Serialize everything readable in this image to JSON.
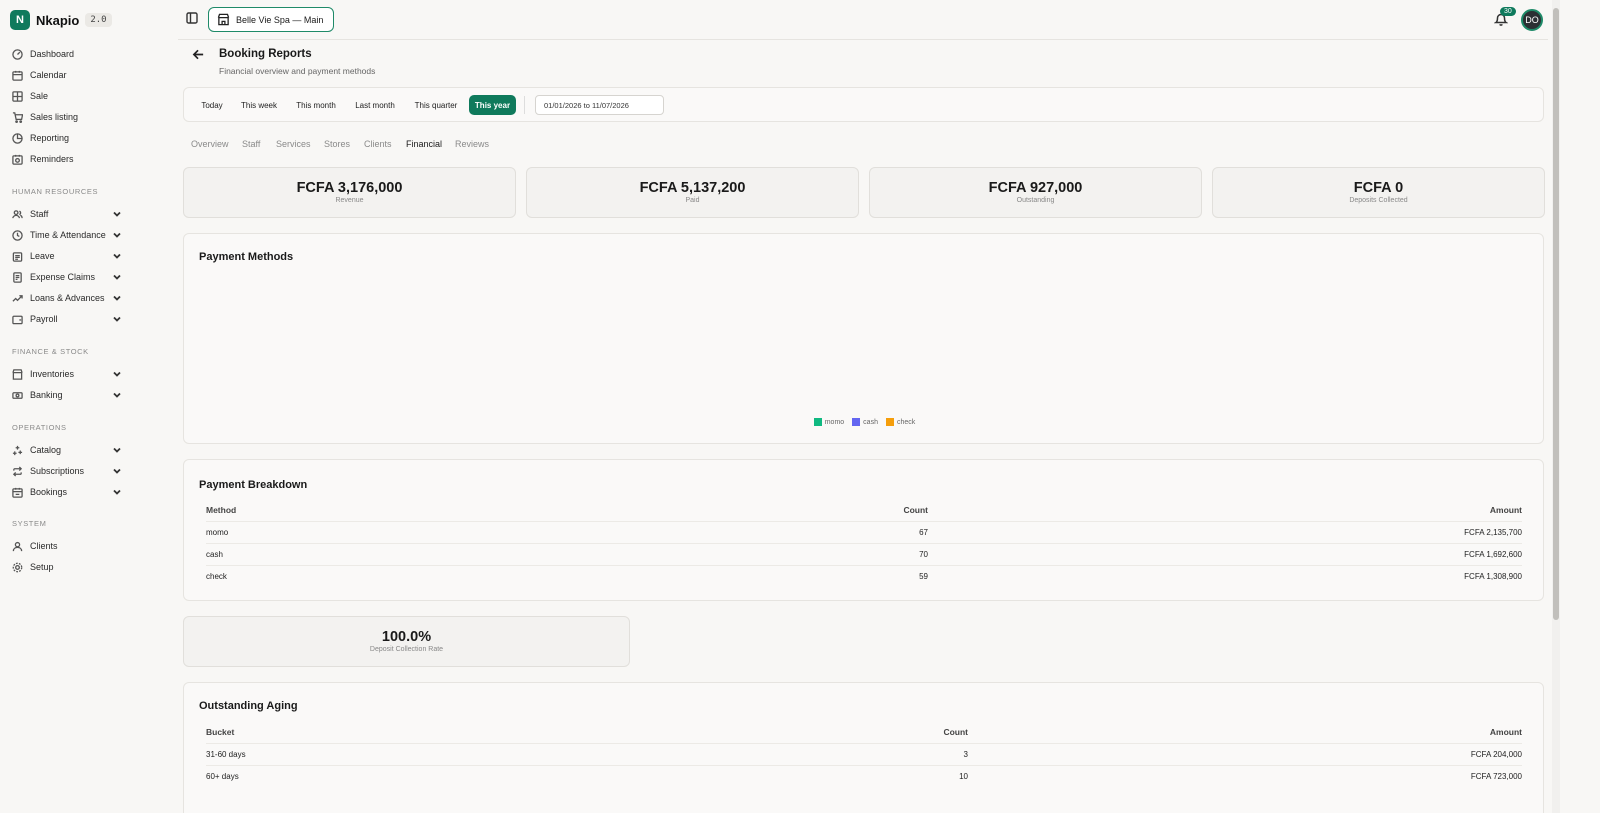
{
  "brand": {
    "initial": "N",
    "name": "Nkapio",
    "version": "2.0"
  },
  "nav": {
    "top": [
      {
        "label": "Dashboard",
        "icon": "dashboard-icon"
      },
      {
        "label": "Calendar",
        "icon": "calendar-icon"
      },
      {
        "label": "Sale",
        "icon": "sale-icon"
      },
      {
        "label": "Sales listing",
        "icon": "cart-icon"
      },
      {
        "label": "Reporting",
        "icon": "chart-icon"
      },
      {
        "label": "Reminders",
        "icon": "reminder-icon"
      }
    ],
    "sections": [
      {
        "label": "HUMAN RESOURCES",
        "items": [
          {
            "label": "Staff"
          },
          {
            "label": "Time & Attendance"
          },
          {
            "label": "Leave"
          },
          {
            "label": "Expense Claims"
          },
          {
            "label": "Loans & Advances"
          },
          {
            "label": "Payroll"
          }
        ]
      },
      {
        "label": "FINANCE & STOCK",
        "items": [
          {
            "label": "Inventories"
          },
          {
            "label": "Banking"
          }
        ]
      },
      {
        "label": "OPERATIONS",
        "items": [
          {
            "label": "Catalog"
          },
          {
            "label": "Subscriptions"
          },
          {
            "label": "Bookings"
          }
        ]
      },
      {
        "label": "SYSTEM",
        "items": [
          {
            "label": "Clients"
          },
          {
            "label": "Setup"
          }
        ]
      }
    ]
  },
  "topbar": {
    "store": "Belle Vie Spa — Main",
    "notifications": "30",
    "avatar": "DO"
  },
  "page": {
    "title": "Booking Reports",
    "subtitle": "Financial overview and payment methods"
  },
  "filters": {
    "buttons": [
      "Today",
      "This week",
      "This month",
      "Last month",
      "This quarter",
      "This year"
    ],
    "active": "This year",
    "date_range": "01/01/2026 to 11/07/2026"
  },
  "tabs": [
    "Overview",
    "Staff",
    "Services",
    "Stores",
    "Clients",
    "Financial",
    "Reviews"
  ],
  "active_tab": "Financial",
  "stats": [
    {
      "value": "FCFA 3,176,000",
      "label": "Revenue"
    },
    {
      "value": "FCFA 5,137,200",
      "label": "Paid"
    },
    {
      "value": "FCFA 927,000",
      "label": "Outstanding"
    },
    {
      "value": "FCFA 0",
      "label": "Deposits Collected"
    }
  ],
  "payment_methods": {
    "title": "Payment Methods",
    "legend": [
      {
        "label": "momo",
        "color": "#10b981"
      },
      {
        "label": "cash",
        "color": "#6366f1"
      },
      {
        "label": "check",
        "color": "#f59e0b"
      }
    ]
  },
  "payment_breakdown": {
    "title": "Payment Breakdown",
    "headers": [
      "Method",
      "Count",
      "Amount"
    ],
    "rows": [
      [
        "momo",
        "67",
        "FCFA 2,135,700"
      ],
      [
        "cash",
        "70",
        "FCFA 1,692,600"
      ],
      [
        "check",
        "59",
        "FCFA 1,308,900"
      ]
    ]
  },
  "deposit_rate": {
    "value": "100.0%",
    "label": "Deposit Collection Rate"
  },
  "outstanding_aging": {
    "title": "Outstanding Aging",
    "headers": [
      "Bucket",
      "Count",
      "Amount"
    ],
    "rows": [
      [
        "31-60 days",
        "3",
        "FCFA 204,000"
      ],
      [
        "60+ days",
        "10",
        "FCFA 723,000"
      ]
    ]
  },
  "colors": {
    "accent": "#0f7a5c"
  }
}
